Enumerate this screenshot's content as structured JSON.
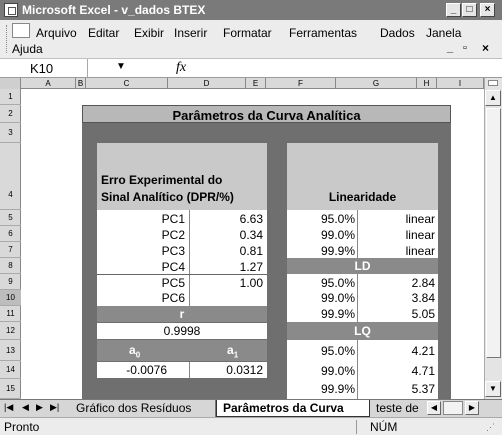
{
  "window": {
    "title": "Microsoft Excel - v_dados BTEX"
  },
  "menu": [
    "Arquivo",
    "Editar",
    "Exibir",
    "Inserir",
    "Formatar",
    "Ferramentas",
    "Dados",
    "Janela",
    "Ajuda"
  ],
  "formula_bar": {
    "name_box": "K10",
    "fx": "fx"
  },
  "columns": [
    "A",
    "B",
    "C",
    "D",
    "E",
    "F",
    "G",
    "H",
    "I"
  ],
  "rows": [
    "1",
    "2",
    "3",
    "4",
    "5",
    "6",
    "7",
    "8",
    "9",
    "10",
    "11",
    "12",
    "13",
    "14",
    "15"
  ],
  "sheet": {
    "heading": "Parâmetros da Curva Analítica",
    "left_header_line1": "Erro Experimental do",
    "left_header_line2": "Sinal Analítico (DPR/%)",
    "pc_rows": [
      {
        "label": "PC1",
        "value": "6.63"
      },
      {
        "label": "PC2",
        "value": "0.34"
      },
      {
        "label": "PC3",
        "value": "0.81"
      },
      {
        "label": "PC4",
        "value": "1.27"
      },
      {
        "label": "PC5",
        "value": "1.00"
      },
      {
        "label": "PC6",
        "value": ""
      }
    ],
    "r_label": "r",
    "r_value": "0.9998",
    "a0_label": "a",
    "a0_sub": "0",
    "a1_label": "a",
    "a1_sub": "1",
    "a0_value": "-0.0076",
    "a1_value": "0.0312",
    "linearidade_header": "Linearidade",
    "lin_rows": [
      {
        "pct": "95.0%",
        "value": "linear"
      },
      {
        "pct": "99.0%",
        "value": "linear"
      },
      {
        "pct": "99.9%",
        "value": "linear"
      }
    ],
    "ld_header": "LD",
    "ld_rows": [
      {
        "pct": "95.0%",
        "value": "2.84"
      },
      {
        "pct": "99.0%",
        "value": "3.84"
      },
      {
        "pct": "99.9%",
        "value": "5.05"
      }
    ],
    "lq_header": "LQ",
    "lq_rows": [
      {
        "pct": "95.0%",
        "value": "4.21"
      },
      {
        "pct": "99.0%",
        "value": "4.71"
      },
      {
        "pct": "99.9%",
        "value": "5.37"
      }
    ]
  },
  "tabs": [
    {
      "label": "Gráfico dos Resíduos",
      "active": false
    },
    {
      "label": "Parâmetros da Curva",
      "active": true
    },
    {
      "label": "teste de",
      "active": false
    }
  ],
  "status": {
    "left": "Pronto",
    "right": "NÚM"
  }
}
